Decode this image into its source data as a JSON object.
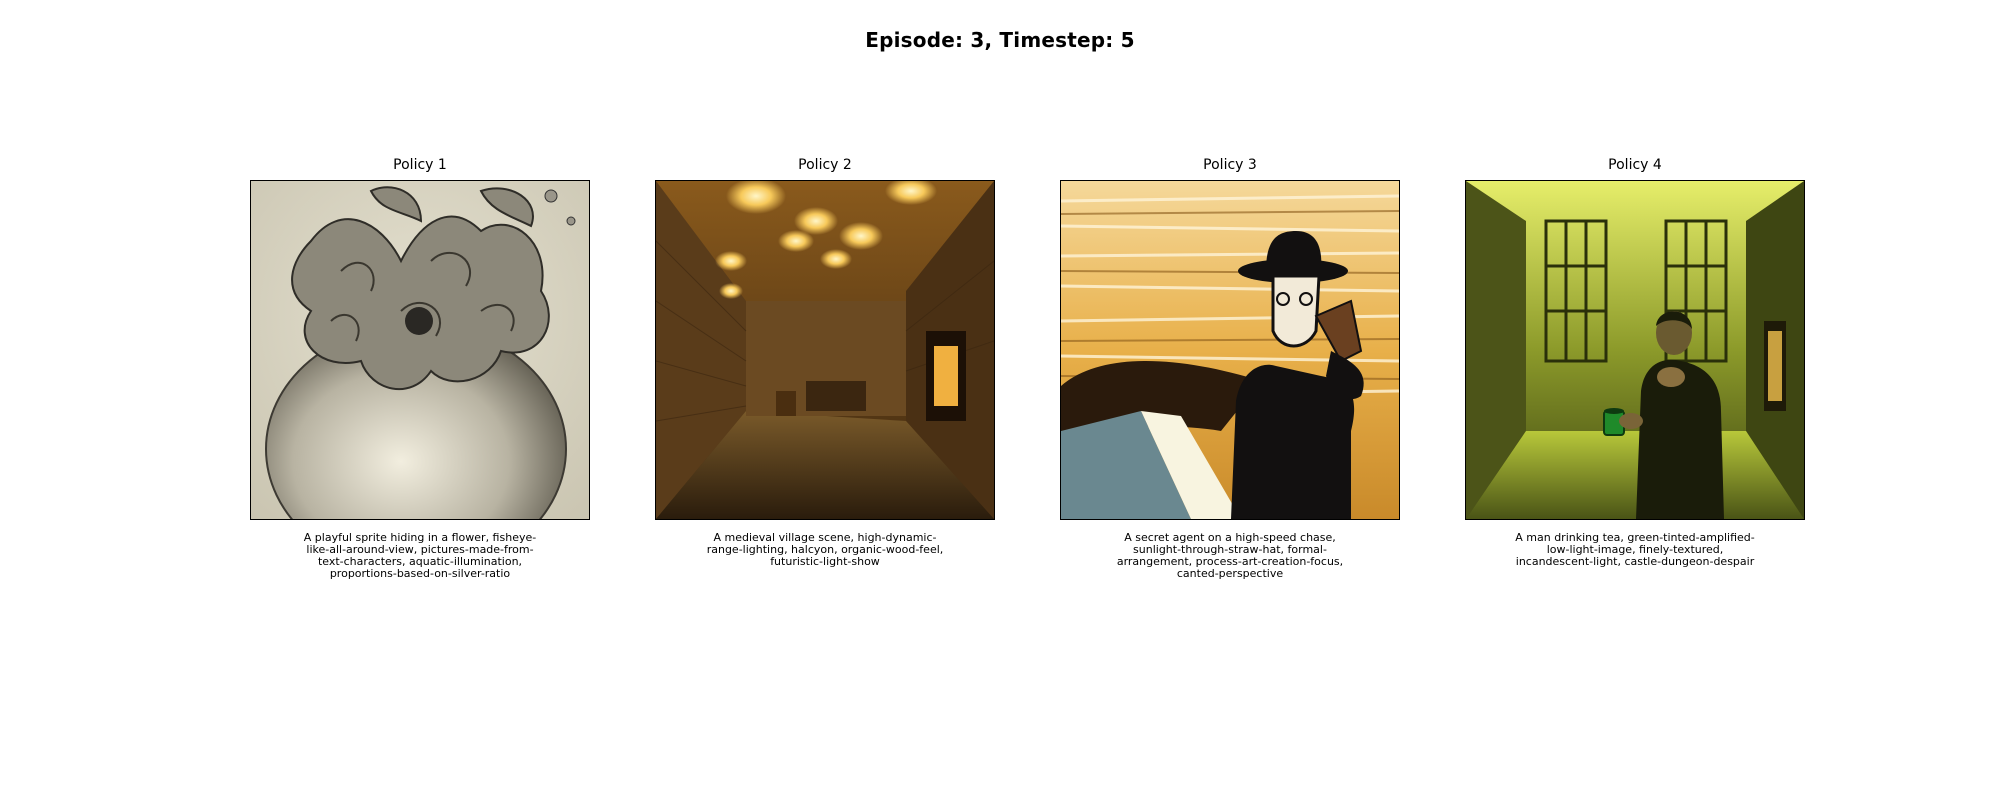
{
  "header": {
    "title": "Episode: 3, Timestep: 5"
  },
  "panels": [
    {
      "title": "Policy 1",
      "image_icon": "vase-flower-sketch-image",
      "caption": "A playful sprite hiding in a flower, fisheye-like-all-around-view, pictures-made-from-text-characters, aquatic-illumination, proportions-based-on-silver-ratio"
    },
    {
      "title": "Policy 2",
      "image_icon": "medieval-cellar-image",
      "caption": "A medieval village scene, high-dynamic-range-lighting, halcyon, organic-wood-feel, futuristic-light-show"
    },
    {
      "title": "Policy 3",
      "image_icon": "secret-agent-silhouette-image",
      "caption": "A secret agent on a high-speed chase, sunlight-through-straw-hat, formal-arrangement, process-art-creation-focus, canted-perspective"
    },
    {
      "title": "Policy 4",
      "image_icon": "man-drinking-tea-dungeon-image",
      "caption": "A man drinking tea, green-tinted-amplified-low-light-image, finely-textured, incandescent-light, castle-dungeon-despair"
    }
  ]
}
